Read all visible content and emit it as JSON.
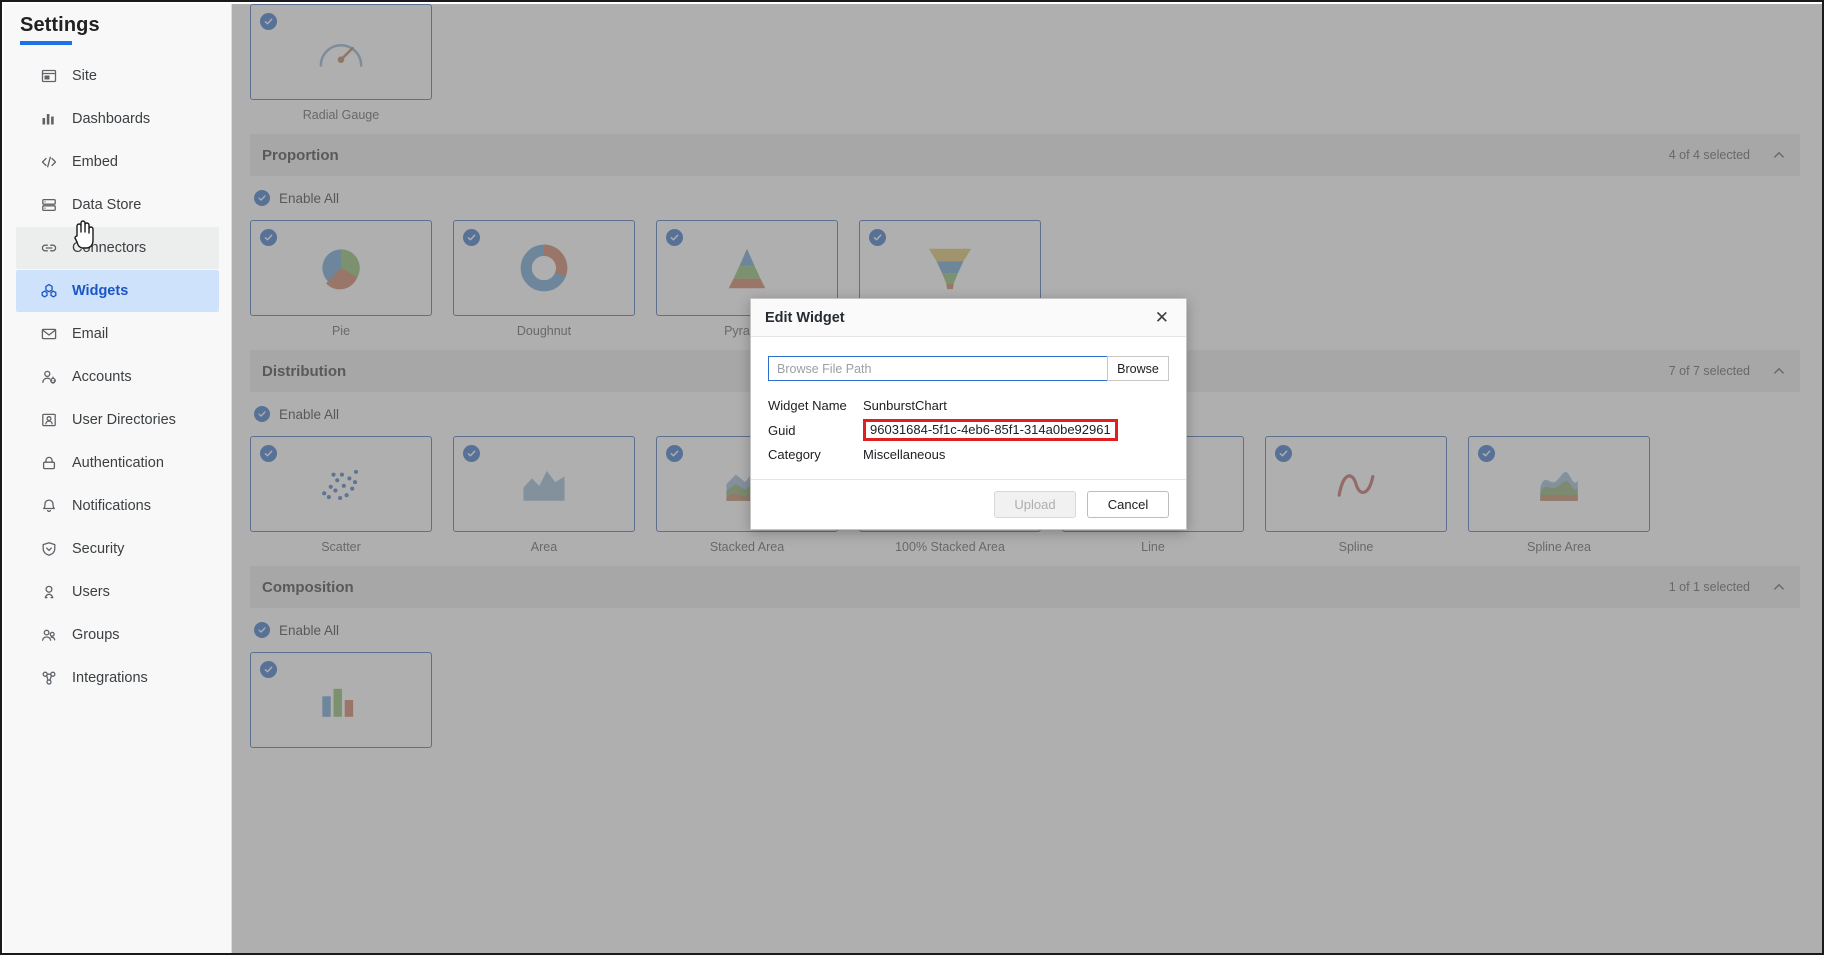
{
  "sidebar": {
    "title": "Settings",
    "items": [
      {
        "label": "Site",
        "icon": "site-icon",
        "state": "default"
      },
      {
        "label": "Dashboards",
        "icon": "dashboards-icon",
        "state": "default"
      },
      {
        "label": "Embed",
        "icon": "embed-icon",
        "state": "default"
      },
      {
        "label": "Data Store",
        "icon": "data-store-icon",
        "state": "default"
      },
      {
        "label": "Connectors",
        "icon": "connectors-icon",
        "state": "hovered"
      },
      {
        "label": "Widgets",
        "icon": "widgets-icon",
        "state": "active"
      },
      {
        "label": "Email",
        "icon": "email-icon",
        "state": "default"
      },
      {
        "label": "Accounts",
        "icon": "accounts-icon",
        "state": "default"
      },
      {
        "label": "User Directories",
        "icon": "user-directories-icon",
        "state": "default"
      },
      {
        "label": "Authentication",
        "icon": "authentication-icon",
        "state": "default"
      },
      {
        "label": "Notifications",
        "icon": "notifications-icon",
        "state": "default"
      },
      {
        "label": "Security",
        "icon": "security-icon",
        "state": "default"
      },
      {
        "label": "Users",
        "icon": "users-icon",
        "state": "default"
      },
      {
        "label": "Groups",
        "icon": "groups-icon",
        "state": "default"
      },
      {
        "label": "Integrations",
        "icon": "integrations-icon",
        "state": "default"
      }
    ]
  },
  "main": {
    "top_cards": [
      {
        "label": "Radial Gauge",
        "thumb": "radial-gauge-thumb",
        "checked": true
      }
    ],
    "sections": [
      {
        "title": "Proportion",
        "count_text": "4 of 4 selected",
        "collapse_icon": "chevron-up-icon",
        "enable_all_label": "Enable All",
        "enable_all_checked": true,
        "cards": [
          {
            "label": "Pie",
            "thumb": "pie-thumb",
            "checked": true
          },
          {
            "label": "Doughnut",
            "thumb": "doughnut-thumb",
            "checked": true
          },
          {
            "label": "Pyramid",
            "thumb": "pyramid-thumb",
            "checked": true
          },
          {
            "label": "Funnel",
            "thumb": "funnel-thumb",
            "checked": true
          }
        ]
      },
      {
        "title": "Distribution",
        "count_text": "7 of 7 selected",
        "collapse_icon": "chevron-up-icon",
        "enable_all_label": "Enable All",
        "enable_all_checked": true,
        "cards": [
          {
            "label": "Scatter",
            "thumb": "scatter-thumb",
            "checked": true
          },
          {
            "label": "Area",
            "thumb": "area-thumb",
            "checked": true
          },
          {
            "label": "Stacked Area",
            "thumb": "stacked-area-thumb",
            "checked": true
          },
          {
            "label": "100% Stacked Area",
            "thumb": "stacked-area-100-thumb",
            "checked": true
          },
          {
            "label": "Line",
            "thumb": "line-thumb",
            "checked": true
          },
          {
            "label": "Spline",
            "thumb": "spline-thumb",
            "checked": true
          },
          {
            "label": "Spline Area",
            "thumb": "spline-area-thumb",
            "checked": true
          }
        ]
      },
      {
        "title": "Composition",
        "count_text": "1 of 1 selected",
        "collapse_icon": "chevron-up-icon",
        "enable_all_label": "Enable All",
        "enable_all_checked": true,
        "cards": [
          {
            "label": "",
            "thumb": "composition-thumb",
            "checked": true
          }
        ]
      }
    ]
  },
  "modal": {
    "title": "Edit Widget",
    "close_icon": "close-icon",
    "file_path_value": "",
    "file_path_placeholder": "Browse File Path",
    "browse_label": "Browse",
    "fields": [
      {
        "key": "Widget Name",
        "value": "SunburstChart",
        "highlighted": false
      },
      {
        "key": "Guid",
        "value": "96031684-5f1c-4eb6-85f1-314a0be92961",
        "highlighted": true
      },
      {
        "key": "Category",
        "value": "Miscellaneous",
        "highlighted": false
      }
    ],
    "upload_label": "Upload",
    "upload_disabled": true,
    "cancel_label": "Cancel"
  },
  "colors": {
    "accent": "#1a73e8",
    "active_nav_bg": "#cfe2fb",
    "card_border": "#4a74b8",
    "check_fill": "#3c78c8",
    "highlight_border": "#e02020",
    "section_bar": "#eeeeee"
  }
}
